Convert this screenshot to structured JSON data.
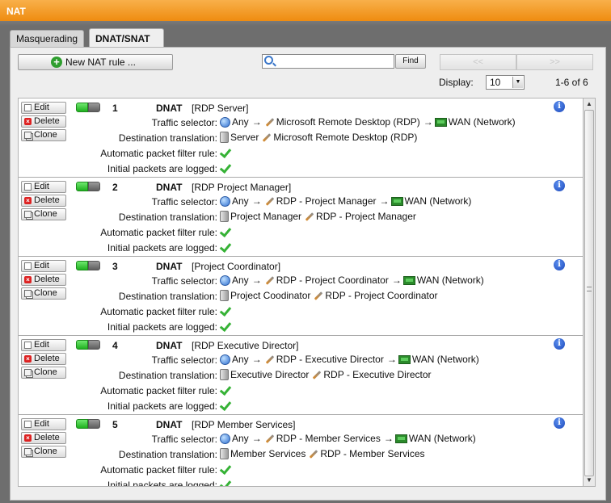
{
  "window": {
    "title": "NAT"
  },
  "tabs": [
    {
      "label": "Masquerading"
    },
    {
      "label": "DNAT/SNAT"
    }
  ],
  "toolbar": {
    "new_rule_label": "New NAT rule ...",
    "search_placeholder": "",
    "find_label": "Find",
    "prev_label": "<<",
    "next_label": ">>",
    "display_label": "Display:",
    "display_value": "10",
    "count_label": "1-6 of 6"
  },
  "labels": {
    "edit": "Edit",
    "delete": "Delete",
    "clone": "Clone",
    "traffic_selector": "Traffic selector:",
    "destination_translation": "Destination translation:",
    "auto_filter": "Automatic packet filter rule:",
    "initial_logged": "Initial packets are logged:",
    "arrow": "→"
  },
  "rules": [
    {
      "num": "1",
      "type": "DNAT",
      "name": "[RDP Server]",
      "source": "Any",
      "service": "Microsoft Remote Desktop (RDP)",
      "interface": "WAN (Network)",
      "dest_host": "Server",
      "dest_service": "Microsoft Remote Desktop (RDP)"
    },
    {
      "num": "2",
      "type": "DNAT",
      "name": "[RDP Project Manager]",
      "source": "Any",
      "service": "RDP - Project Manager",
      "interface": "WAN (Network)",
      "dest_host": "Project Manager",
      "dest_service": "RDP - Project Manager"
    },
    {
      "num": "3",
      "type": "DNAT",
      "name": "[Project Coordinator]",
      "source": "Any",
      "service": "RDP - Project Coordinator",
      "interface": "WAN (Network)",
      "dest_host": "Project Coodinator",
      "dest_service": "RDP - Project Coordinator"
    },
    {
      "num": "4",
      "type": "DNAT",
      "name": "[RDP Executive Director]",
      "source": "Any",
      "service": "RDP - Executive Director",
      "interface": "WAN (Network)",
      "dest_host": "Executive Director",
      "dest_service": "RDP - Executive Director"
    },
    {
      "num": "5",
      "type": "DNAT",
      "name": "[RDP Member Services]",
      "source": "Any",
      "service": "RDP - Member Services",
      "interface": "WAN (Network)",
      "dest_host": "Member Services",
      "dest_service": "RDP - Member Services"
    }
  ],
  "icons": {
    "enabled": "toggle-on-icon",
    "info": "info-icon",
    "check": "check-icon",
    "network": "globe-icon",
    "service": "plug-icon",
    "interface": "nic-icon",
    "host": "server-icon"
  },
  "colors": {
    "titlebar": "#ef8c10",
    "panel": "#eeeeee",
    "check": "#36b236"
  }
}
